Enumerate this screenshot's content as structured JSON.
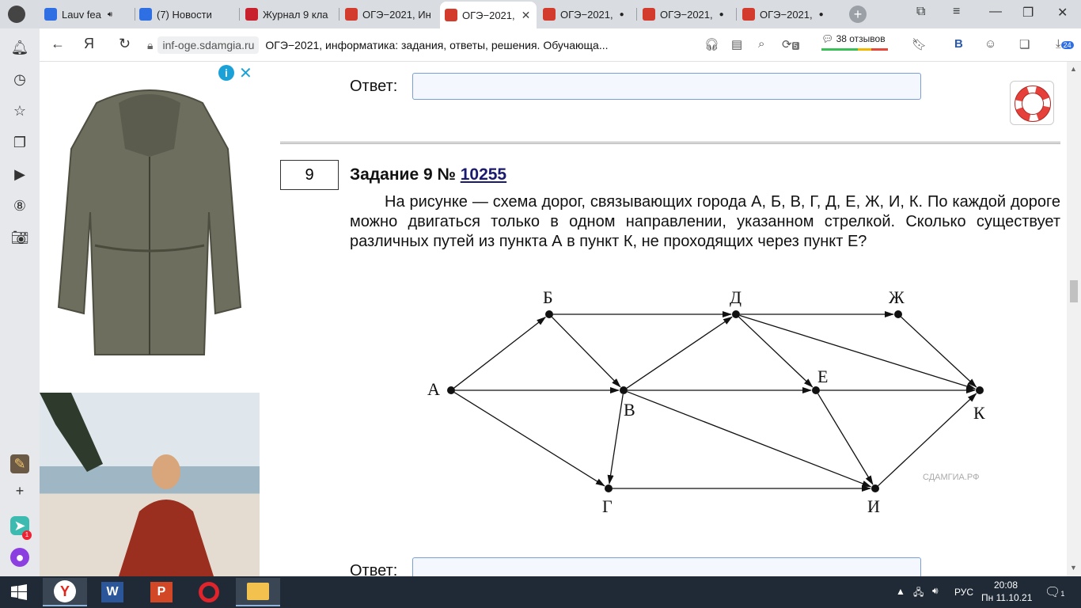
{
  "tabs": [
    {
      "label": "Lauv fea",
      "icon": "video-icon",
      "color": "#2f6fe4"
    },
    {
      "label": "(7) Новости",
      "icon": "vk-icon",
      "color": "#2f6fe4"
    },
    {
      "label": "Журнал 9 кла",
      "icon": "journal-icon",
      "color": "#c8202c"
    },
    {
      "label": "ОГЭ−2021, Ин",
      "icon": "sdamgia-icon",
      "color": "#d33b2c"
    },
    {
      "label": "ОГЭ−2021,",
      "icon": "sdamgia-icon",
      "color": "#d33b2c",
      "active": true
    },
    {
      "label": "ОГЭ−2021,",
      "icon": "sdamgia-icon",
      "color": "#d33b2c"
    },
    {
      "label": "ОГЭ−2021,",
      "icon": "sdamgia-icon",
      "color": "#d33b2c"
    },
    {
      "label": "ОГЭ−2021,",
      "icon": "sdamgia-icon",
      "color": "#d33b2c"
    }
  ],
  "address": {
    "host": "inf-oge.sdamgia.ru",
    "title": "ОГЭ−2021, информатика: задания, ответы, решения. Обучающа...",
    "reviews": "38 отзывов",
    "downloads_badge": "24",
    "tab_count_badge": "5"
  },
  "sidebar": {
    "badge": "1"
  },
  "content": {
    "answer_label_top": "Ответ:",
    "answer_label_bottom": "Ответ:",
    "task_number": "9",
    "task_title": "Задание 9 № ",
    "task_link": "10255",
    "task_text": "На рисунке — схема дорог, связывающих города А, Б, В, Г, Д, Е, Ж, И, К. По каждой дороге можно двигаться только в одном направлении, указанном стрелкой. Сколько существует различных путей из пункта А в пункт К, не проходящих через пункт Е?",
    "graph": {
      "watermark": "СДАМГИА.РФ",
      "nodes": [
        {
          "id": "А",
          "label": "А"
        },
        {
          "id": "Б",
          "label": "Б"
        },
        {
          "id": "В",
          "label": "В"
        },
        {
          "id": "Г",
          "label": "Г"
        },
        {
          "id": "Д",
          "label": "Д"
        },
        {
          "id": "Е",
          "label": "Е"
        },
        {
          "id": "Ж",
          "label": "Ж"
        },
        {
          "id": "И",
          "label": "И"
        },
        {
          "id": "К",
          "label": "К"
        }
      ],
      "edges": [
        [
          "А",
          "Б"
        ],
        [
          "А",
          "В"
        ],
        [
          "А",
          "Г"
        ],
        [
          "Б",
          "Д"
        ],
        [
          "Б",
          "В"
        ],
        [
          "В",
          "Д"
        ],
        [
          "В",
          "Е"
        ],
        [
          "В",
          "И"
        ],
        [
          "В",
          "Г"
        ],
        [
          "Г",
          "И"
        ],
        [
          "Д",
          "Ж"
        ],
        [
          "Д",
          "Е"
        ],
        [
          "Д",
          "К"
        ],
        [
          "Е",
          "К"
        ],
        [
          "Е",
          "И"
        ],
        [
          "Ж",
          "К"
        ],
        [
          "И",
          "К"
        ]
      ]
    }
  },
  "taskbar": {
    "lang": "РУС",
    "time": "20:08",
    "date": "Пн 11.10.21",
    "notif": "1"
  }
}
